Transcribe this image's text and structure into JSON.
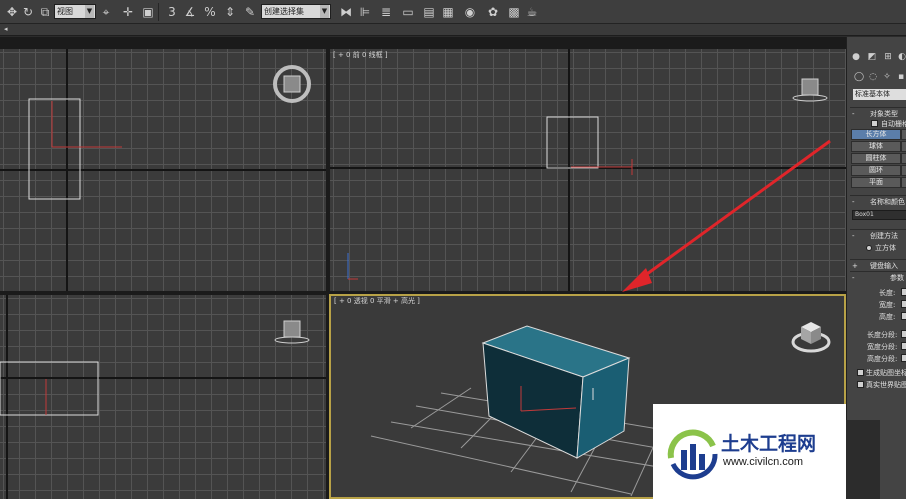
{
  "toolbar": {
    "view_dropdown": "视图",
    "selection_set_dropdown": "创建选择集"
  },
  "viewports": {
    "perspective_label": "[ + 0 透视 0 平滑 + 高光 ]",
    "front_label": "[ + 0 前 0 线框 ]"
  },
  "panel": {
    "category_dropdown": "标准基本体",
    "object_type_rollout": "对象类型",
    "autogrid_label": "自动栅格",
    "object_buttons": [
      "长方体",
      "球体",
      "圆柱体",
      "圆环",
      "平面"
    ],
    "name_color_rollout": "名称和颜色",
    "object_name_value": "Box01",
    "creation_method_rollout": "创建方法",
    "cube_radio_label": "立方体",
    "keyboard_entry_rollout": "键盘输入",
    "parameters_rollout": "参数",
    "length_label": "长度:",
    "width_label": "宽度:",
    "height_label": "高度:",
    "length_segs_label": "长度分段:",
    "width_segs_label": "宽度分段:",
    "height_segs_label": "高度分段:",
    "gen_mapping_label": "生成贴图坐标",
    "real_world_label": "真实世界贴图大小"
  },
  "watermark": {
    "brand": "土木工程网",
    "url": "www.civilcn.com"
  },
  "colors": {
    "active_viewport_border": "#b8a247",
    "box_color": "#1d5f74",
    "arrow_color": "#e0252a",
    "active_button": "#5b7eaa",
    "watermark_blue": "#1d3d8f",
    "watermark_green": "#8bc34a"
  },
  "icons": [
    "move-icon",
    "rotate-icon",
    "scale-icon",
    "snap-icon",
    "angle-snap-icon",
    "percent-snap-icon",
    "mirror-icon",
    "align-icon",
    "layer-icon",
    "graph-editor-icon",
    "material-editor-icon",
    "render-setup-icon",
    "render-icon",
    "teapot-icon"
  ]
}
